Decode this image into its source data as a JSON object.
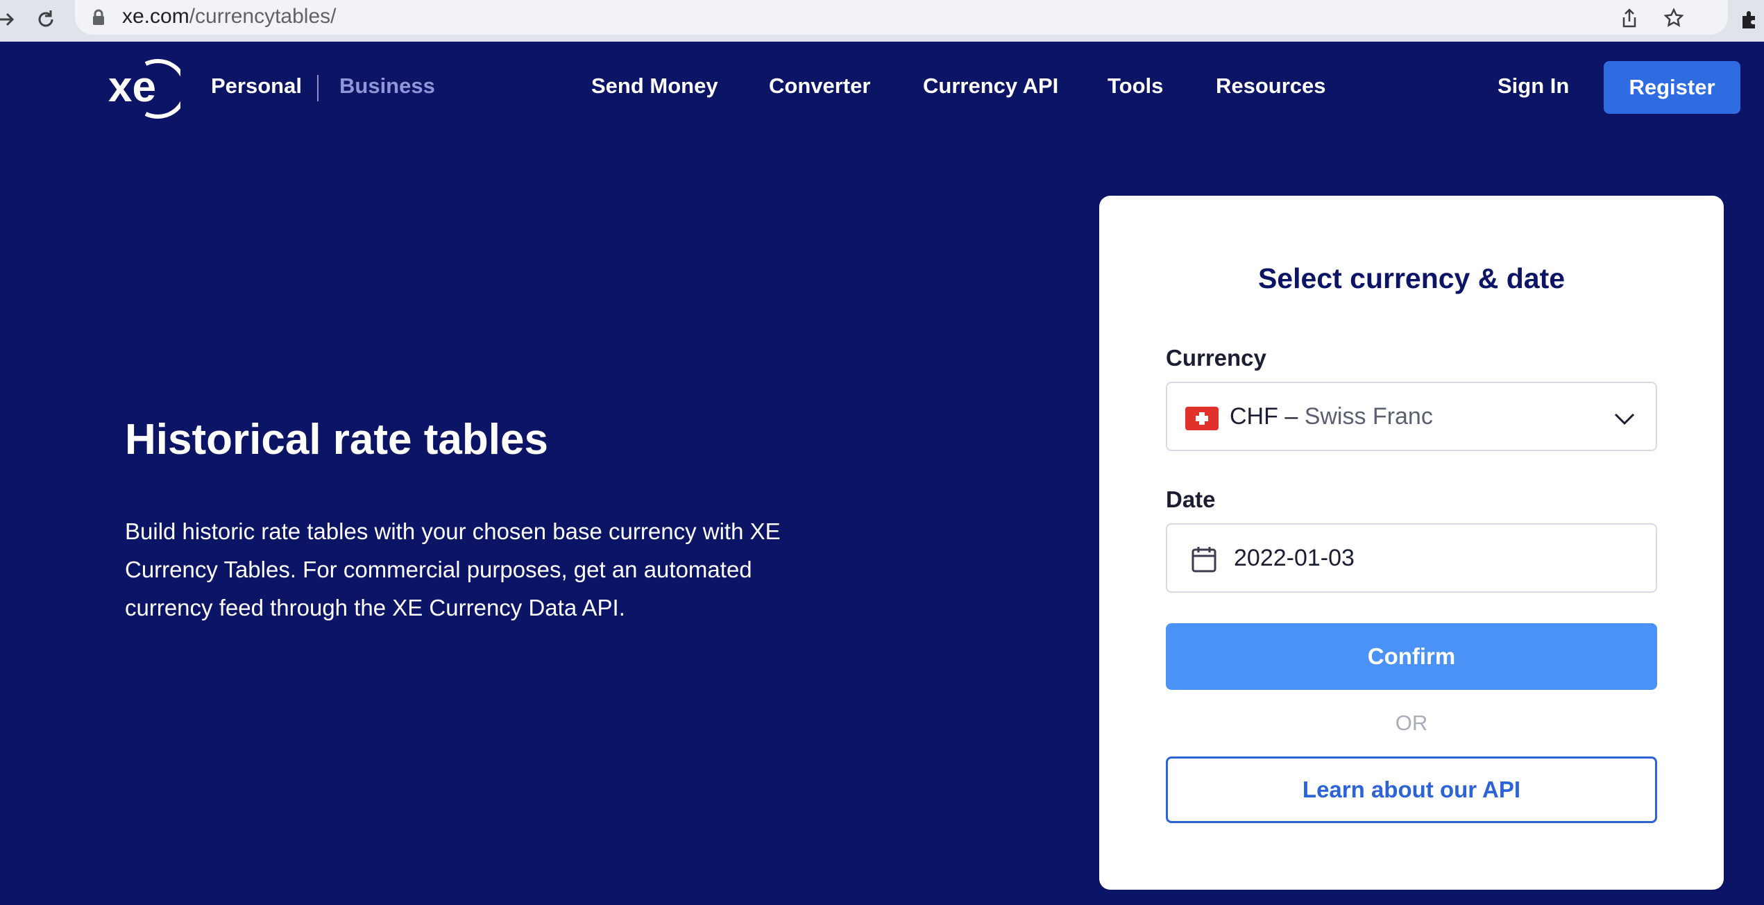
{
  "browser": {
    "url_host": "xe.com",
    "url_path": "/currencytables/"
  },
  "nav": {
    "segments": {
      "personal": "Personal",
      "business": "Business"
    },
    "links": [
      "Send Money",
      "Converter",
      "Currency API",
      "Tools",
      "Resources"
    ],
    "sign_in": "Sign In",
    "register": "Register"
  },
  "hero": {
    "title": "Historical rate tables",
    "description": "Build historic rate tables with your chosen base currency with XE Currency Tables. For commercial purposes, get an automated currency feed through the XE Currency Data API."
  },
  "card": {
    "title": "Select currency & date",
    "currency_label": "Currency",
    "currency_code": "CHF",
    "currency_separator": " – ",
    "currency_name": "Swiss Franc",
    "date_label": "Date",
    "date_value": "2022-01-03",
    "confirm_label": "Confirm",
    "or_label": "OR",
    "learn_api_label": "Learn about our API"
  },
  "colors": {
    "background": "#0c1466",
    "register": "#2f6be1",
    "confirm": "#4a92f5",
    "link_blue": "#2c63d6",
    "business_muted": "#8f97d9"
  },
  "icons": [
    "back-arrow-icon",
    "reload-icon",
    "lock-icon",
    "share-icon",
    "star-icon",
    "extensions-icon",
    "xe-logo",
    "swiss-flag-icon",
    "chevron-down-icon",
    "calendar-icon"
  ]
}
